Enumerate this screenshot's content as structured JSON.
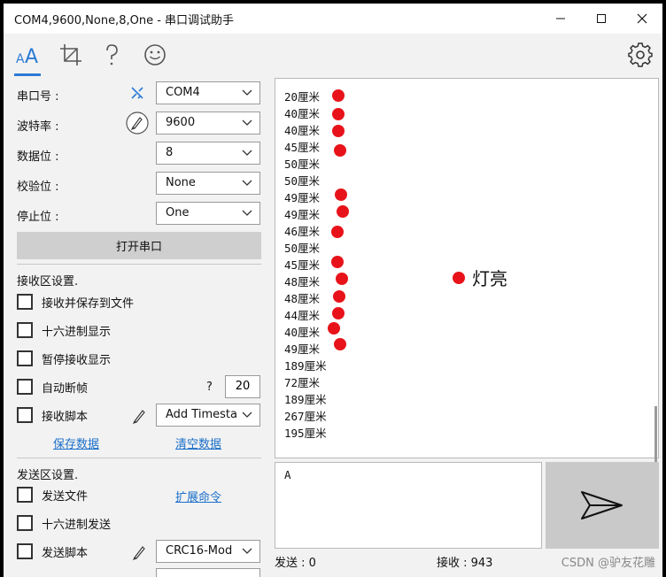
{
  "window": {
    "title": "COM4,9600,None,8,One  -  串口调试助手"
  },
  "toolbar": {
    "icons": [
      "font-icon",
      "crop-icon",
      "help-icon",
      "smiley-icon",
      "gear-icon"
    ]
  },
  "settings": {
    "port_label": "串口号 :",
    "port_value": "COM4",
    "baud_label": "波特率 :",
    "baud_value": "9600",
    "databits_label": "数据位 :",
    "databits_value": "8",
    "parity_label": "校验位 :",
    "parity_value": "None",
    "stopbits_label": "停止位 :",
    "stopbits_value": "One",
    "open_button": "打开串口"
  },
  "receive_settings": {
    "heading": "接收区设置.",
    "save_to_file": "接收并保存到文件",
    "hex_display": "十六进制显示",
    "pause_display": "暂停接收显示",
    "auto_frame": "自动断帧",
    "auto_frame_q": "?",
    "auto_frame_value": "20",
    "script": "接收脚本",
    "script_value": "Add Timesta",
    "save_data": "保存数据",
    "clear_data": "清空数据"
  },
  "send_settings": {
    "heading": "发送区设置.",
    "send_file": "发送文件",
    "expand_cmd": "扩展命令",
    "hex_send": "十六进制发送",
    "script": "发送脚本",
    "script_value": "CRC16-Mod"
  },
  "receive_lines": [
    "20厘米",
    "40厘米",
    "40厘米",
    "45厘米",
    "50厘米",
    "50厘米",
    "49厘米",
    "49厘米",
    "46厘米",
    "50厘米",
    "45厘米",
    "48厘米",
    "48厘米",
    "44厘米",
    "40厘米",
    "49厘米",
    "189厘米",
    "72厘米",
    "189厘米",
    "267厘米",
    "195厘米"
  ],
  "legend": {
    "label": "灯亮",
    "color": "#e8131a"
  },
  "send_area": {
    "text": "A"
  },
  "status": {
    "sent": "发送 : 0",
    "received": "接收 : 943"
  },
  "watermark": "CSDN @驴友花雕"
}
